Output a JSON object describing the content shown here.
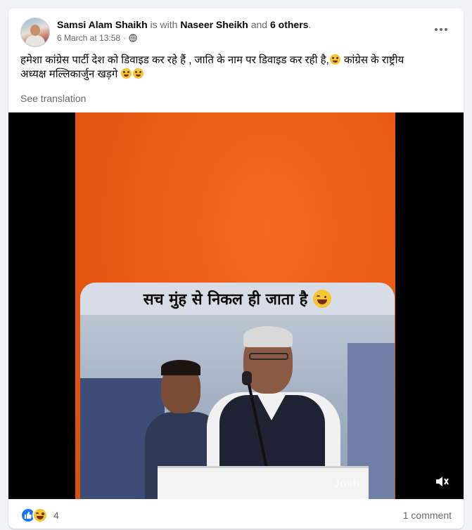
{
  "post": {
    "author": "Samsi Alam Shaikh",
    "with_text": "is with",
    "tagged_person": "Naseer Sheikh",
    "and_text": "and",
    "others": "6 others",
    "period": ".",
    "date": "6 March at 13:58",
    "separator": "·",
    "privacy_icon": "globe-icon",
    "text_line1": "हमेशा कांग्रेस पार्टी देश को डिवाइड कर रहे हैं , जाति के नाम पर डिवाइड कर रही है,",
    "text_line1b": " कांग्रेस के राष्ट्रीय",
    "text_line2": "अध्यक्ष मल्लिकार्जुन खड़गे ",
    "see_translation": "See translation"
  },
  "video": {
    "caption": "सच मुंह से निकल ही जाता है",
    "watermark": "Josh",
    "sound_icon": "speaker-muted-icon"
  },
  "footer": {
    "reaction_count": "4",
    "comments": "1 comment",
    "reaction_icons": [
      "like-icon",
      "haha-icon"
    ]
  },
  "colors": {
    "video_background": "#e85a12",
    "like_blue": "#1877f2",
    "secondary_text": "#65676b"
  }
}
